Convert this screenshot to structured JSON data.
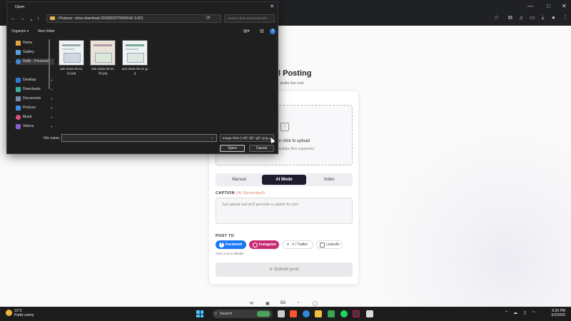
{
  "browser": {
    "window_controls": [
      "—",
      "□",
      "✕"
    ]
  },
  "page": {
    "title": "l Posting",
    "subtitle": "andle the rest.",
    "upload": {
      "text": "or click to upload",
      "sub": "multiple files supported"
    },
    "modes": [
      {
        "label": "Manual",
        "active": false
      },
      {
        "label": "AI Mode",
        "active": true
      },
      {
        "label": "Video",
        "active": false
      }
    ],
    "caption": {
      "label": "CAPTION",
      "ai_tag": "(AI Generated)",
      "placeholder": "Just upload and we'll generate a caption for you!"
    },
    "post_to": {
      "label": "POST TO",
      "platforms": [
        {
          "label": "Facebook",
          "selected": true,
          "color": "#1877f2"
        },
        {
          "label": "Instagram",
          "selected": true,
          "color": "#c72a71"
        },
        {
          "label": "X / Twitter",
          "selected": false
        },
        {
          "label": "LinkedIn",
          "selected": false
        }
      ],
      "hint": "Click icon to disable"
    },
    "submit_label": "Submit post",
    "footer_icons": [
      "mail-icon",
      "linkedin-icon",
      "behance-icon",
      "github-icon",
      "whatsapp-icon"
    ]
  },
  "dialog": {
    "title": "Open",
    "address": "›  Pictures  ›  drive-download-20260502T090404Z-3-001",
    "search_placeholder": "Search drive-download-202...",
    "organize_label": "Organize ▾",
    "new_folder_label": "New folder",
    "nav_items": [
      {
        "label": "Home",
        "icon_color": "#e8a33c",
        "pinned": false
      },
      {
        "label": "Gallery",
        "icon_color": "#5aa0e0",
        "pinned": false
      },
      {
        "label": "Raffy - Personal",
        "icon_color": "#3d8ee0",
        "pinned": false,
        "selected": true
      },
      {
        "label": "Desktop",
        "icon_color": "#2f7bd8",
        "pinned": true
      },
      {
        "label": "Downloads",
        "icon_color": "#3cb0a0",
        "pinned": true
      },
      {
        "label": "Documents",
        "icon_color": "#7a8ca8",
        "pinned": true
      },
      {
        "label": "Pictures",
        "icon_color": "#3f8ee6",
        "pinned": true
      },
      {
        "label": "Music",
        "icon_color": "#e0508a",
        "pinned": true
      },
      {
        "label": "Videos",
        "icon_color": "#8a5ad8",
        "pinned": true
      }
    ],
    "files": [
      {
        "name": "ads-2026-05-01(1).jpg"
      },
      {
        "name": "ads-2026-05-01(2).jpg"
      },
      {
        "name": "ads-2026-05-01.jpg"
      }
    ],
    "file_name_label": "File name:",
    "file_name_value": "",
    "file_type": "Image Files (*.tiff;*.jfif;*.gif;*.png...",
    "open_label": "Open",
    "cancel_label": "Cancel"
  },
  "taskbar": {
    "weather_temp": "31°C",
    "weather_desc": "Partly sunny",
    "search_label": "Search",
    "time": "5:26 PM",
    "date": "5/2/2026"
  }
}
